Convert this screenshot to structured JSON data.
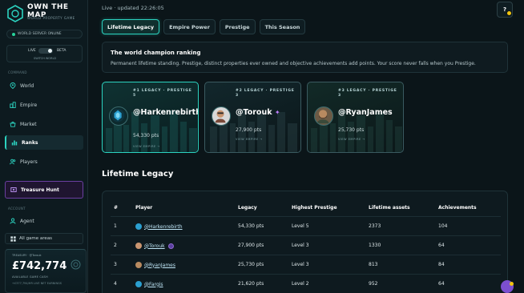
{
  "brand": {
    "title_line1": "OWN THE",
    "title_line2": "MAP",
    "subtitle": "WORLD PROPERTY GAME"
  },
  "server": {
    "status": "WORLD SERVER ONLINE",
    "status_color": "#28d39b"
  },
  "mode": {
    "live": "LIVE",
    "beta": "BETA",
    "switch_label": "SWITCH WORLD"
  },
  "nav": {
    "section_command": "COMMAND",
    "items": [
      {
        "label": "World",
        "icon": "pin-icon"
      },
      {
        "label": "Empire",
        "icon": "buildings-icon"
      },
      {
        "label": "Market",
        "icon": "market-icon"
      },
      {
        "label": "Ranks",
        "icon": "bar-chart-icon",
        "active": true
      },
      {
        "label": "Players",
        "icon": "users-icon"
      }
    ],
    "treasure": "Treasure Hunt",
    "section_account": "ACCOUNT",
    "agent": "Agent",
    "all_areas": "All game areas"
  },
  "cash": {
    "treasury": "TREASURY · @Torouk",
    "value": "£742,774",
    "label": "AVAILABLE GAME CASH",
    "net": "+£377,794/HR LIVE NET EARNINGS"
  },
  "header": {
    "live_updated": "Live · updated 22:26:05",
    "help": "?"
  },
  "tabs": [
    "Lifetime Legacy",
    "Empire Power",
    "Prestige",
    "This Season"
  ],
  "info": {
    "title": "The world champion ranking",
    "text": "Permanent lifetime standing. Prestige, distinct properties ever owned and objective achievements add points. Your score never falls when you Prestige."
  },
  "podium": [
    {
      "rank": "#1 LEGACY · PRESTIGE 5",
      "name": "@Harkenrebirth",
      "pts": "54,330 pts",
      "view": "VIEW EMPIRE →"
    },
    {
      "rank": "#2 LEGACY · PRESTIGE 3",
      "name": "@Torouk",
      "pts": "27,900 pts",
      "view": "VIEW EMPIRE →"
    },
    {
      "rank": "#3 LEGACY · PRESTIGE 3",
      "name": "@RyanJames",
      "pts": "25,730 pts",
      "view": "VIEW EMPIRE →"
    }
  ],
  "table": {
    "title": "Lifetime Legacy",
    "headers": [
      "#",
      "Player",
      "Legacy",
      "Highest Prestige",
      "Lifetime assets",
      "Achievements"
    ],
    "rows": [
      {
        "rank": "1",
        "player": "@Harkenrebirth",
        "legacy": "54,330 pts",
        "prestige": "Level 5",
        "assets": "2373",
        "achievements": "104"
      },
      {
        "rank": "2",
        "player": "@Torouk",
        "legacy": "27,900 pts",
        "prestige": "Level 3",
        "assets": "1330",
        "achievements": "64"
      },
      {
        "rank": "3",
        "player": "@RyanJames",
        "legacy": "25,730 pts",
        "prestige": "Level 3",
        "assets": "813",
        "achievements": "84"
      },
      {
        "rank": "4",
        "player": "@Fargis",
        "legacy": "21,620 pts",
        "prestige": "Level 2",
        "assets": "952",
        "achievements": "64"
      }
    ]
  },
  "colors": {
    "accent": "#2cd3c0",
    "treasure": "#6b3fa0",
    "background": "#0b1519"
  }
}
